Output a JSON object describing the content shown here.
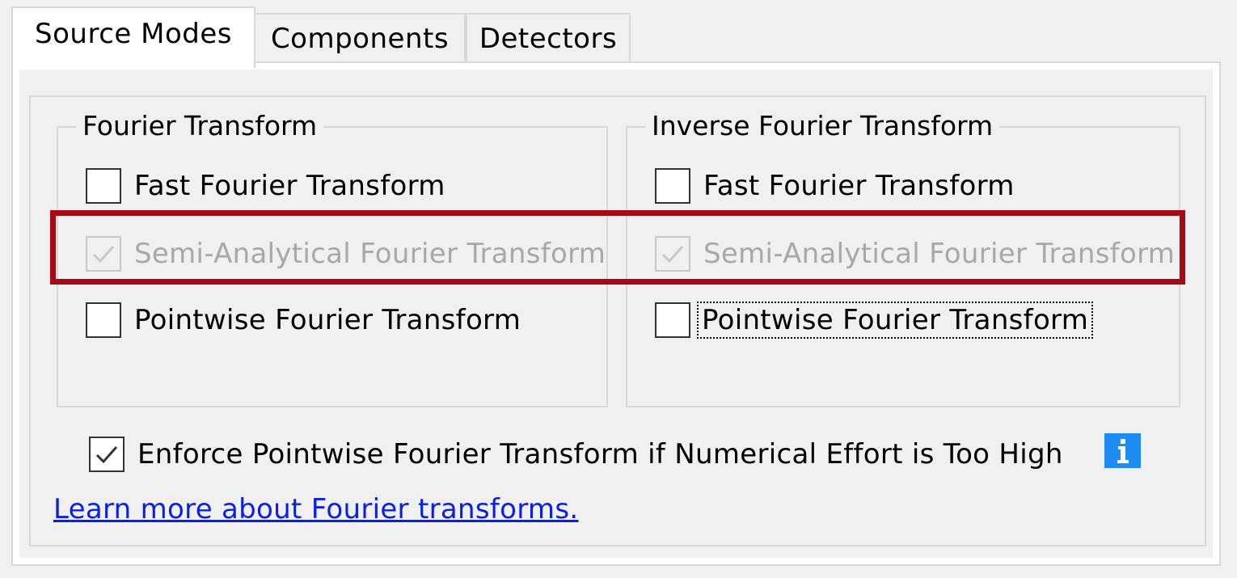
{
  "tabs": [
    {
      "label": "Source Modes",
      "active": true
    },
    {
      "label": "Components",
      "active": false
    },
    {
      "label": "Detectors",
      "active": false
    }
  ],
  "groups": {
    "fourier": {
      "title": "Fourier Transform",
      "options": [
        {
          "label": "Fast Fourier Transform",
          "checked": false,
          "enabled": true
        },
        {
          "label": "Semi-Analytical Fourier Transform",
          "checked": true,
          "enabled": false
        },
        {
          "label": "Pointwise Fourier Transform",
          "checked": false,
          "enabled": true
        }
      ]
    },
    "inverse": {
      "title": "Inverse Fourier Transform",
      "options": [
        {
          "label": "Fast Fourier Transform",
          "checked": false,
          "enabled": true
        },
        {
          "label": "Semi-Analytical Fourier Transform",
          "checked": true,
          "enabled": false
        },
        {
          "label": "Pointwise Fourier Transform",
          "checked": false,
          "enabled": true,
          "focused": true
        }
      ]
    }
  },
  "enforce": {
    "label": "Enforce Pointwise Fourier Transform if Numerical Effort is Too High",
    "checked": true
  },
  "info_icon": "info-icon",
  "link": {
    "label": "Learn more about Fourier transforms."
  },
  "colors": {
    "highlight": "#a50b17",
    "link": "#0a1fe0",
    "info": "#1e8cf2",
    "disabled_text": "#a8a8a8"
  }
}
